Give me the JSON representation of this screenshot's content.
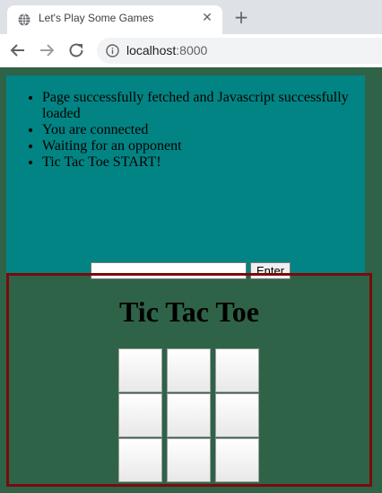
{
  "browser": {
    "tab_title": "Let's Play Some Games",
    "url_host": "localhost",
    "url_port": ":8000",
    "icons": [
      "globe-icon",
      "close-icon",
      "plus-icon",
      "back-arrow-icon",
      "forward-arrow-icon",
      "reload-icon",
      "info-icon"
    ]
  },
  "log": {
    "items": [
      "Page successfully fetched and Javascript successfully loaded",
      "You are connected",
      "Waiting for an opponent",
      "Tic Tac Toe START!"
    ]
  },
  "input": {
    "value": "",
    "placeholder": ""
  },
  "enter_label": "Enter",
  "game": {
    "title": "Tic Tac Toe",
    "cells": [
      "",
      "",
      "",
      "",
      "",
      "",
      "",
      "",
      ""
    ]
  },
  "colors": {
    "page_bg": "#2e6347",
    "log_bg": "#028484",
    "game_border": "#7a0b0b"
  }
}
